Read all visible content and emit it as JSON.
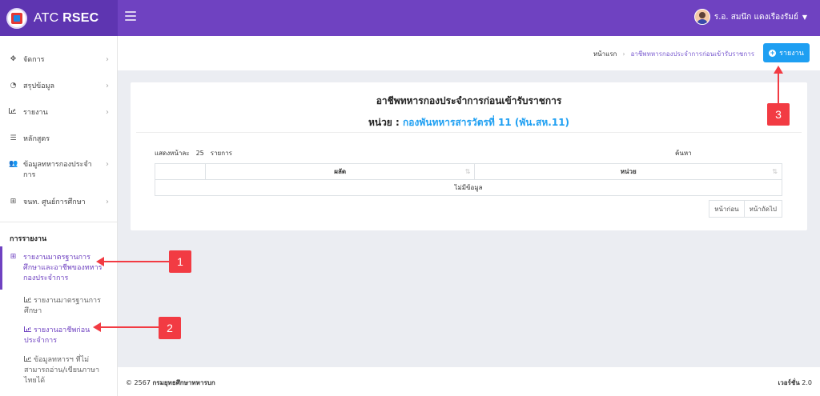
{
  "app": {
    "brand_prefix": "ATC",
    "brand_bold": "RSEC"
  },
  "user": {
    "name": "ร.อ. สมนึก แดงเรืองรัมย์"
  },
  "sidebar": {
    "items": [
      {
        "label": "จัดการ",
        "icon": "arrows-move-icon",
        "glyph": "✥"
      },
      {
        "label": "สรุปข้อมูล",
        "icon": "pie-chart-icon",
        "glyph": "◔"
      },
      {
        "label": "รายงาน",
        "icon": "bar-chart-icon",
        "glyph": ""
      },
      {
        "label": "หลักสูตร",
        "icon": "list-icon",
        "glyph": "☰"
      },
      {
        "label": "ข้อมูลทหารกองประจำการ",
        "icon": "users-icon",
        "glyph": "👥"
      },
      {
        "label": "จนท. ศูนย์การศึกษา",
        "icon": "grid-icon",
        "glyph": "⊞"
      }
    ],
    "section_title": "การรายงาน",
    "active_group": {
      "label": "รายงานมาตรฐานการศึกษาและอาชีพของทหารกองประจำการ",
      "icon": "grid-icon",
      "glyph": "⊞"
    },
    "sub_items": [
      {
        "label": "รายงานมาตรฐานการศึกษา"
      },
      {
        "label": "รายงานอาชีพก่อนประจำการ"
      },
      {
        "label": "ข้อมูลทหารฯ ที่ไม่สามารถอ่าน/เขียนภาษาไทยได้"
      }
    ]
  },
  "breadcrumb": {
    "home": "หน้าแรก",
    "current": "อาชีพทหารกองประจำการก่อนเข้ารับราชการ"
  },
  "report_button": {
    "label": "รายงาน"
  },
  "card": {
    "title": "อาชีพทหารกองประจำการก่อนเข้ารับราชการ",
    "unit_prefix": "หน่วย :",
    "unit_name": "กองพันทหารสารวัตรที่ 11 (พัน.สห.11)",
    "show_label": "แสดงหน้าละ",
    "page_size": "25",
    "rows_label": "รายการ",
    "search_label": "ค้นหา",
    "columns": [
      "",
      "ผลัด",
      "หน่วย"
    ],
    "empty_message": "ไม่มีข้อมูล",
    "prev_label": "หน้าก่อน",
    "next_label": "หน้าถัดไป"
  },
  "footer": {
    "copyright_prefix": "© 2567",
    "org": "กรมยุทธศึกษาทหารบก",
    "version_label": "เวอร์ชั่น",
    "version": "2.0"
  },
  "annotations": [
    {
      "label": "1"
    },
    {
      "label": "2"
    },
    {
      "label": "3"
    }
  ],
  "colors": {
    "header": "#6f42c1",
    "brand_bg": "#5e35b1",
    "accent_blue": "#1e9ff2",
    "marker_red": "#f23b43"
  }
}
